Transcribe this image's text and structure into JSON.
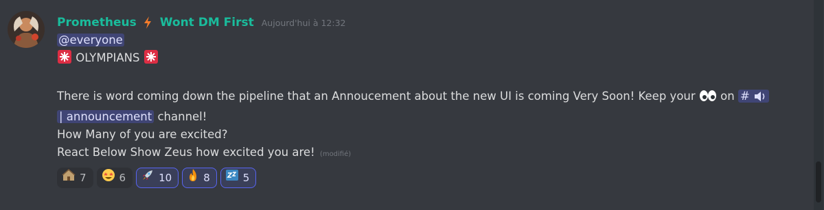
{
  "message": {
    "author": "Prometheus",
    "separator_icon": "lightning-icon",
    "tag": "Wont DM First",
    "timestamp": "Aujourd'hui à 12:32",
    "mention": "@everyone",
    "heading": "OLYMPIANS",
    "body_1": "There is word coming down the pipeline that an Annoucement about the new UI is coming Very Soon! Keep your",
    "body_1_after": "on",
    "channel_prefix": "#",
    "channel_name": "| announcement",
    "body_2_after": "channel!",
    "line_3": "How Many of you are excited?",
    "line_4": "React Below Show Zeus how excited you are!",
    "edited_label": "(modifié)"
  },
  "reactions": [
    {
      "icon": "house-icon",
      "count": "7",
      "active": false
    },
    {
      "icon": "star-struck-icon",
      "count": "6",
      "active": false
    },
    {
      "icon": "rocket-icon",
      "count": "10",
      "active": true
    },
    {
      "icon": "fire-icon",
      "count": "8",
      "active": true
    },
    {
      "icon": "zzz-icon",
      "count": "5",
      "active": true
    }
  ],
  "colors": {
    "background": "#36393f",
    "username": "#1abc9c",
    "mention_bg": "#4c5480",
    "accent": "#5865f2"
  }
}
